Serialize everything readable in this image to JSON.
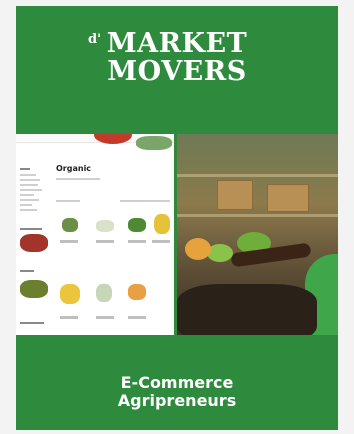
{
  "brand": {
    "superscript": "d'",
    "line1": "MARKET",
    "line2": "MOVERS"
  },
  "mock_site": {
    "heading": "Organic"
  },
  "tagline": {
    "line1": "E-Commerce",
    "line2": "Agripreneurs"
  },
  "colors": {
    "card_green": "#2e8b3e",
    "text": "#ffffff"
  }
}
